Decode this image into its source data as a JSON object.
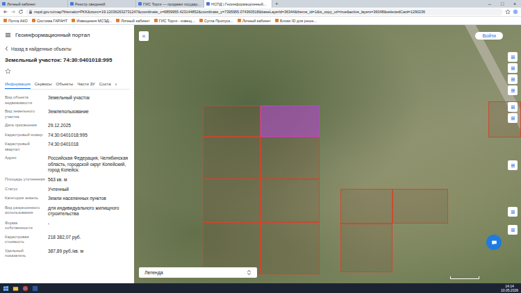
{
  "browser": {
    "tabs": [
      {
        "label": "Личный кабинет",
        "selected": false
      },
      {
        "label": "Реестр сведений",
        "selected": false
      },
      {
        "label": "ГИС Торги — продажи государ...",
        "selected": false
      },
      {
        "label": "НСПД | Геоинформационный...",
        "selected": true
      }
    ],
    "new_tab": "+",
    "window_controls": [
      "–",
      "□",
      "×"
    ],
    "address": "nspd.gov.ru/map?thematic=PKK&zoom=19.120362632731247&coordinate_x=6859955.423144852&coordinate_y=7395955.074360518&baseLayerId=36344&theme_id=1&is_copy_url=true&active_layers=36048&selectedCard=1290236",
    "bookmarks": [
      "Почта АКО",
      "Система ГАРАНТ",
      "Извещения МСЭД...",
      "Личный кабинет",
      "ГИС Торги - извещ...",
      "Сугла Пропуск...",
      "Личный кабинет",
      "Блоки ID для реше..."
    ]
  },
  "portal": {
    "title": "Геоинформационный портал",
    "back_link": "Назад в найденные объекты",
    "object_title": "Земельный участок: 74:30:0401018:995",
    "favorite": false,
    "tabs": [
      {
        "label": "Информация",
        "selected": true
      },
      {
        "label": "Сервисы",
        "selected": false
      },
      {
        "label": "Объекты",
        "selected": false
      },
      {
        "label": "Части ЗУ",
        "selected": false
      },
      {
        "label": "Соста",
        "selected": false
      }
    ],
    "tabs_more": "›",
    "fields": [
      {
        "label": "Вид объекта недвижимости",
        "value": "Земельный участок"
      },
      {
        "label": "Вид земельного участка",
        "value": "Землепользование"
      },
      {
        "label": "Дата присвоения",
        "value": "29.12.2025"
      },
      {
        "label": "Кадастровый номер",
        "value": "74:30:0401018:995"
      },
      {
        "label": "Кадастровый квартал",
        "value": "74:30:0401018"
      },
      {
        "label": "Адрес",
        "value": "Российская Федерация, Челябинская область, городской округ Копейский, город Копейск."
      },
      {
        "label": "Площадь уточненная",
        "value": "563 кв. м"
      },
      {
        "label": "Статус",
        "value": "Учтенный"
      },
      {
        "label": "Категория земель",
        "value": "Земли населенных пунктов"
      },
      {
        "label": "Вид разрешенного использования",
        "value": "для индивидуального жилищного строительства"
      },
      {
        "label": "Форма собственности",
        "value": "-"
      },
      {
        "label": "Кадастровая стоимость",
        "value": "218 382,07 руб."
      },
      {
        "label": "Удельный показатель",
        "value": "387,89 руб./кв. м"
      }
    ]
  },
  "map": {
    "collapse": "«",
    "login": "Войти",
    "legend": "Легенда",
    "parcels": [
      {
        "selected": false
      },
      {
        "selected": true
      },
      {
        "selected": false
      },
      {
        "selected": false
      },
      {
        "selected": false
      },
      {
        "selected": false
      },
      {
        "selected": false
      },
      {
        "selected": false
      },
      {
        "selected": false
      },
      {
        "selected": false
      },
      {
        "selected": false
      },
      {
        "selected": false
      }
    ]
  },
  "taskbar": {
    "time": "14:14",
    "date": "10.05.2026"
  }
}
